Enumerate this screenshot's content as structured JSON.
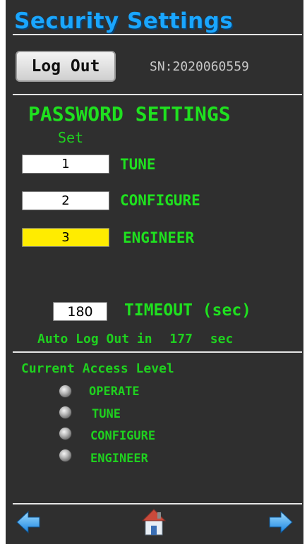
{
  "header": {
    "title": "Security Settings"
  },
  "logout": {
    "label": "Log Out"
  },
  "serial": {
    "text": "SN:2020060559"
  },
  "password": {
    "heading": "PASSWORD SETTINGS",
    "set_label": "Set",
    "levels": [
      {
        "value": "1",
        "label": "TUNE",
        "highlighted": false
      },
      {
        "value": "2",
        "label": "CONFIGURE",
        "highlighted": false
      },
      {
        "value": "3",
        "label": "ENGINEER",
        "highlighted": true
      }
    ]
  },
  "timeout": {
    "value": "180",
    "label": "TIMEOUT (sec)",
    "auto_prefix": "Auto Log Out in",
    "remaining": "177",
    "unit": "sec"
  },
  "access": {
    "heading": "Current Access Level",
    "items": [
      "OPERATE",
      "TUNE",
      "CONFIGURE",
      "ENGINEER"
    ]
  },
  "nav": {
    "back_icon": "left-arrow-icon",
    "home_icon": "home-icon",
    "forward_icon": "right-arrow-icon"
  },
  "colors": {
    "background": "#2f2f2f",
    "title": "#1aa6ff",
    "green": "#1fe11f",
    "highlight": "#ffec00"
  }
}
